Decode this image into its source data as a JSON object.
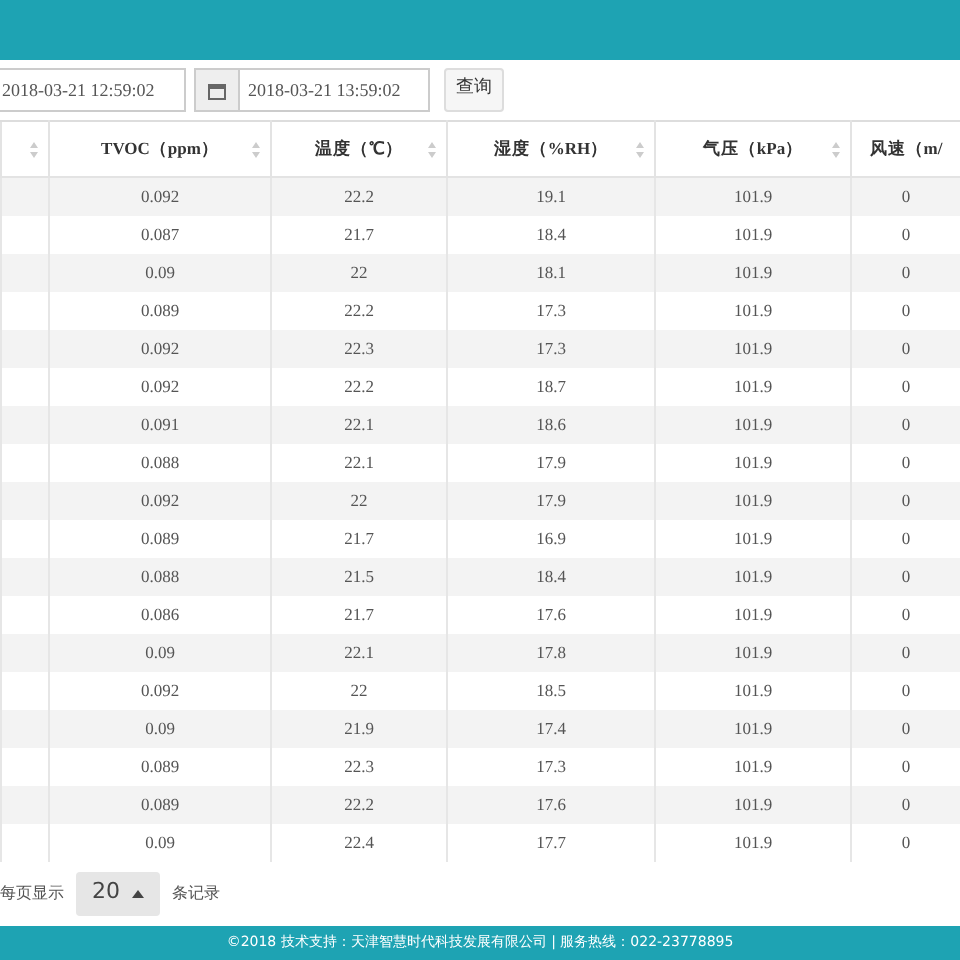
{
  "toolbar": {
    "start_time": "2018-03-21 12:59:02",
    "end_time": "2018-03-21 13:59:02",
    "query_button": "查询"
  },
  "table": {
    "columns": [
      "TVOC（ppm）",
      "温度（℃）",
      "湿度（%RH）",
      "气压（kPa）",
      "风速（m/"
    ],
    "rows": [
      [
        "0.092",
        "22.2",
        "19.1",
        "101.9",
        "0"
      ],
      [
        "0.087",
        "21.7",
        "18.4",
        "101.9",
        "0"
      ],
      [
        "0.09",
        "22",
        "18.1",
        "101.9",
        "0"
      ],
      [
        "0.089",
        "22.2",
        "17.3",
        "101.9",
        "0"
      ],
      [
        "0.092",
        "22.3",
        "17.3",
        "101.9",
        "0"
      ],
      [
        "0.092",
        "22.2",
        "18.7",
        "101.9",
        "0"
      ],
      [
        "0.091",
        "22.1",
        "18.6",
        "101.9",
        "0"
      ],
      [
        "0.088",
        "22.1",
        "17.9",
        "101.9",
        "0"
      ],
      [
        "0.092",
        "22",
        "17.9",
        "101.9",
        "0"
      ],
      [
        "0.089",
        "21.7",
        "16.9",
        "101.9",
        "0"
      ],
      [
        "0.088",
        "21.5",
        "18.4",
        "101.9",
        "0"
      ],
      [
        "0.086",
        "21.7",
        "17.6",
        "101.9",
        "0"
      ],
      [
        "0.09",
        "22.1",
        "17.8",
        "101.9",
        "0"
      ],
      [
        "0.092",
        "22",
        "18.5",
        "101.9",
        "0"
      ],
      [
        "0.09",
        "21.9",
        "17.4",
        "101.9",
        "0"
      ],
      [
        "0.089",
        "22.3",
        "17.3",
        "101.9",
        "0"
      ],
      [
        "0.089",
        "22.2",
        "17.6",
        "101.9",
        "0"
      ],
      [
        "0.09",
        "22.4",
        "17.7",
        "101.9",
        "0"
      ]
    ]
  },
  "pagination": {
    "label_before": "每页显示",
    "page_size": "20",
    "label_after": "条记录"
  },
  "footer": "©2018 技术支持：天津智慧时代科技发展有限公司 | 服务热线：022-23778895"
}
